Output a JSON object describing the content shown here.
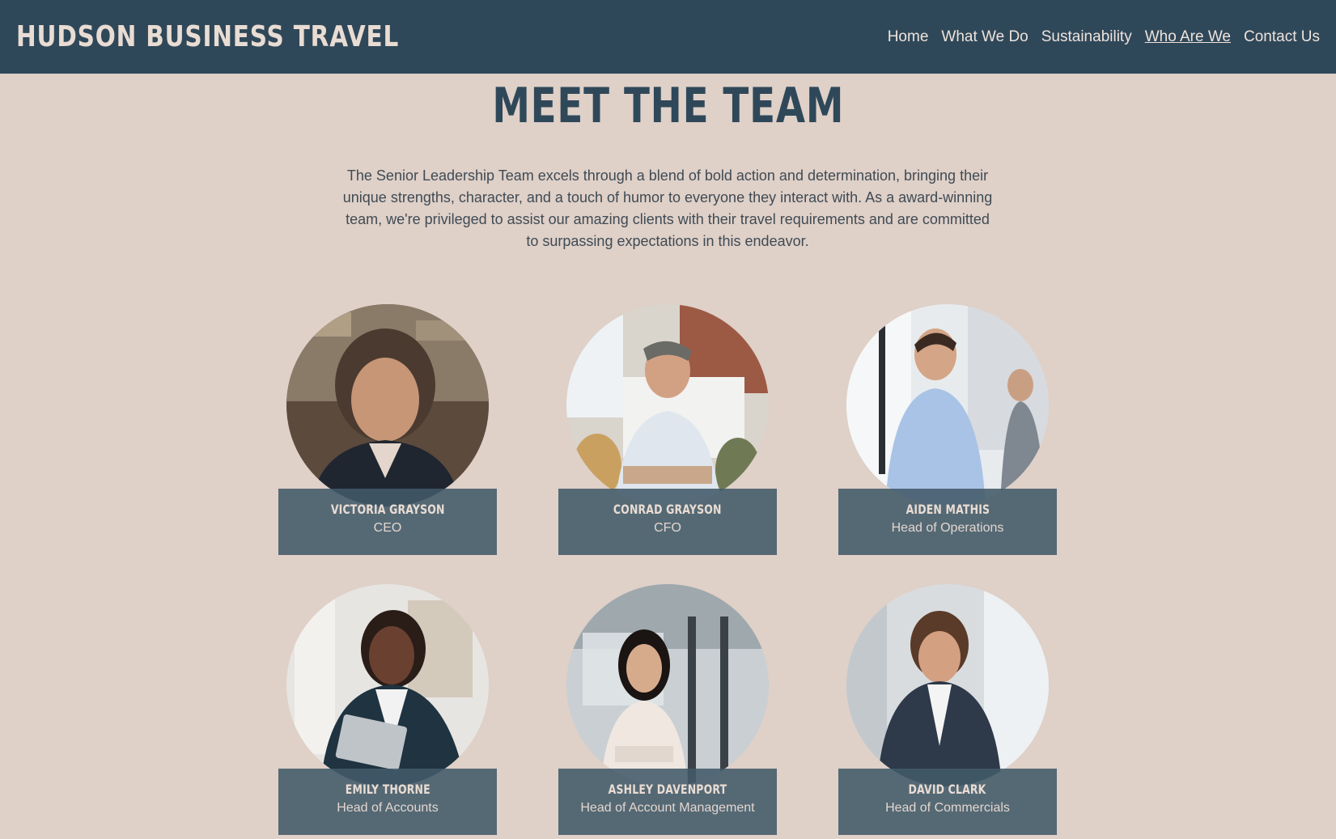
{
  "header": {
    "brand": "HUDSON BUSINESS TRAVEL",
    "nav": [
      "Home",
      "What We Do",
      "Sustainability",
      "Who Are We",
      "Contact Us"
    ],
    "active_nav": "Who Are We"
  },
  "main": {
    "title": "MEET THE TEAM",
    "intro": "The Senior Leadership Team excels through a blend of bold action and determination, bringing their unique strengths, character, and a touch of humor to everyone they interact with. As a award-winning team, we're privileged to assist our amazing clients with their travel requirements and are committed to surpassing expectations in this endeavor.",
    "team": [
      {
        "name": "VICTORIA GRAYSON",
        "role": "CEO"
      },
      {
        "name": "CONRAD GRAYSON",
        "role": "CFO"
      },
      {
        "name": "AIDEN MATHIS",
        "role": "Head of Operations"
      },
      {
        "name": "EMILY THORNE",
        "role": "Head of Accounts"
      },
      {
        "name": "ASHLEY DAVENPORT",
        "role": "Head of Account Management"
      },
      {
        "name": "DAVID CLARK",
        "role": "Head of Commercials"
      }
    ]
  },
  "colors": {
    "header_bg": "#2f4859",
    "page_bg": "#dfd0c8",
    "plate_bg": "#425a69",
    "title": "#2f4859"
  }
}
